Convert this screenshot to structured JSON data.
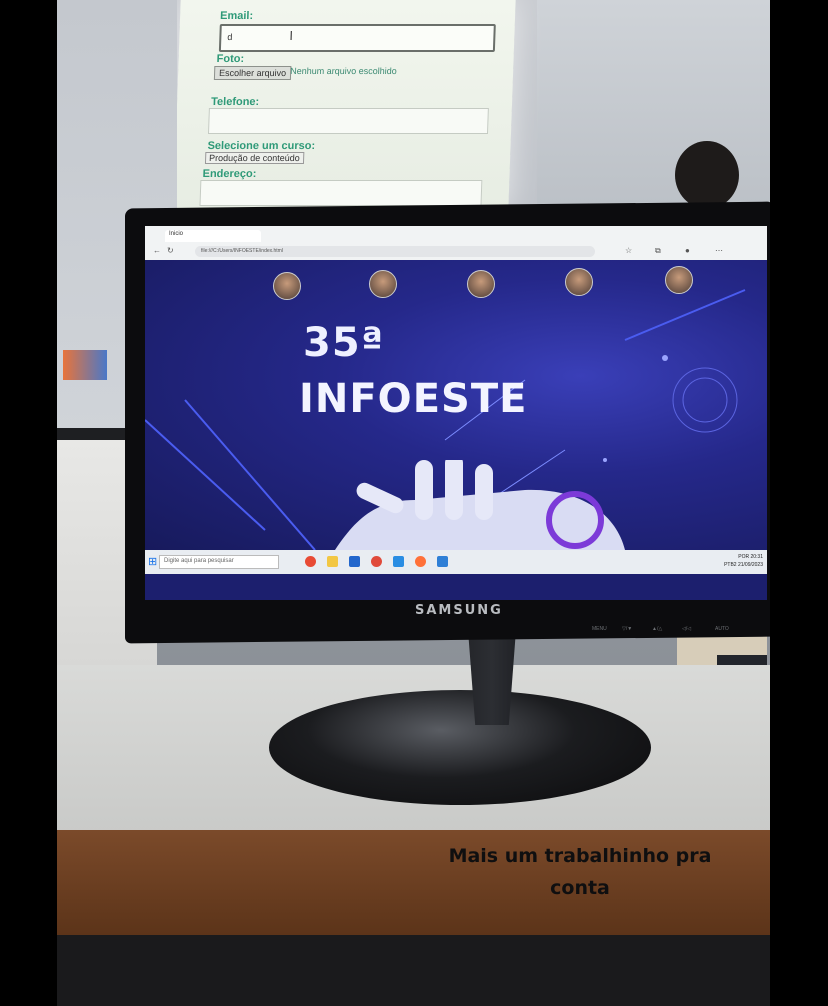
{
  "projection": {
    "email_label": "Email:",
    "email_value": "d",
    "foto_label": "Foto:",
    "file_button": "Escolher arquivo",
    "file_status": "Nenhum arquivo escolhido",
    "telefone_label": "Telefone:",
    "curso_label": "Selecione um curso:",
    "curso_selected": "Produção de conteúdo",
    "endereco_label": "Endereço:"
  },
  "monitor": {
    "tab_title": "Inicio",
    "url": "file:///C:/Users/INFOESTE/index.html",
    "hero_number": "35ª",
    "hero_title": "INFOESTE",
    "search_placeholder": "Digite aqui para pesquisar",
    "clock_lang": "POR",
    "clock_layout": "PTB2",
    "clock_time": "20:31",
    "clock_date": "21/09/2023",
    "brand": "SAMSUNG",
    "buttons": [
      "MENU",
      "▽/▼",
      "▲/△",
      "◁/◁",
      "AUTO"
    ]
  },
  "caption": {
    "line1": "Mais um trabalhinho pra",
    "line2": "conta"
  },
  "colors": {
    "form_label": "#2f9a78",
    "hero_bg": "#25288a",
    "caption_text": "#0f0f10"
  }
}
